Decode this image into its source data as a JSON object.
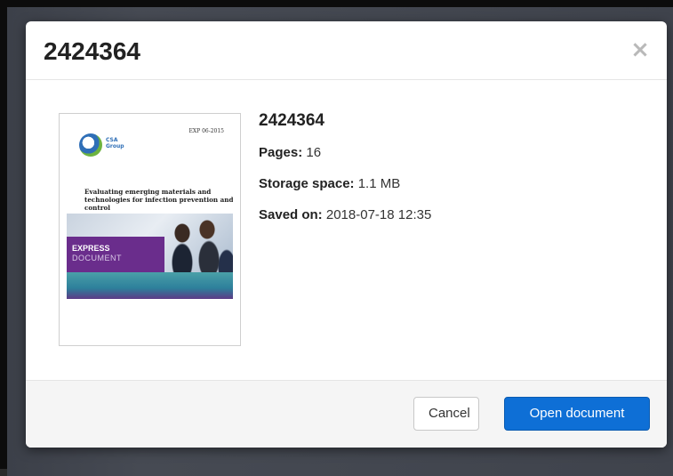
{
  "modal": {
    "title": "2424364",
    "close_glyph": "×"
  },
  "thumbnail": {
    "cover_code": "EXP 06-2015",
    "logo_text_1": "CSA",
    "logo_text_2": "Group",
    "cover_title": "Evaluating emerging materials and technologies for infection prevention and control",
    "band_title": "EXPRESS",
    "band_sub": "DOCUMENT"
  },
  "info": {
    "title": "2424364",
    "pages_label": "Pages:",
    "pages_value": "16",
    "storage_label": "Storage space:",
    "storage_value": "1.1 MB",
    "saved_label": "Saved on:",
    "saved_value": "2018-07-18 12:35"
  },
  "footer": {
    "cancel_label": "Cancel",
    "open_label": "Open document"
  },
  "colors": {
    "primary": "#0e6fd6",
    "cover_purple": "#6a2d8c"
  }
}
